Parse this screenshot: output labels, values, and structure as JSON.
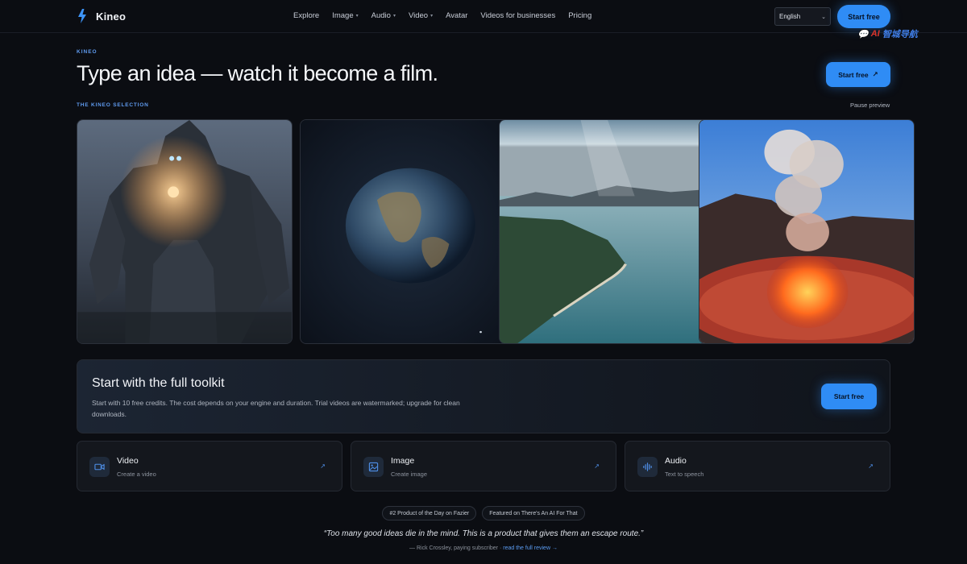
{
  "nav": {
    "brand": "Kineo",
    "items": [
      {
        "label": "Explore",
        "caret": false
      },
      {
        "label": "Image",
        "caret": true
      },
      {
        "label": "Audio",
        "caret": true
      },
      {
        "label": "Video",
        "caret": true
      },
      {
        "label": "Avatar",
        "caret": false
      },
      {
        "label": "Videos for businesses",
        "caret": false
      },
      {
        "label": "Pricing",
        "caret": false
      }
    ],
    "caret_glyph": "▾",
    "language": "English",
    "cta": "Start free"
  },
  "watermark": {
    "prefix": "💬",
    "ai": "AI",
    "text": "智城导航"
  },
  "hero": {
    "eyebrow": "KINEO",
    "title": "Type an idea — watch it become a film.",
    "cta": "Start free",
    "cta_arrow": "↗"
  },
  "selection": {
    "label": "THE KINEO SELECTION",
    "pause": "Pause preview"
  },
  "toolkit": {
    "title": "Start with the full toolkit",
    "description": "Start with 10 free credits. The cost depends on your engine and duration. Trial videos are watermarked; upgrade for clean downloads.",
    "cta": "Start free"
  },
  "tiles": [
    {
      "title": "Video",
      "subtitle": "Create a video",
      "icon": "video-camera-icon",
      "arrow": "↗"
    },
    {
      "title": "Image",
      "subtitle": "Create image",
      "icon": "image-icon",
      "arrow": "↗"
    },
    {
      "title": "Audio",
      "subtitle": "Text to speech",
      "icon": "audio-wave-icon",
      "arrow": "↗"
    }
  ],
  "badges": [
    "#2 Product of the Day on Fazier",
    "Featured on There's An AI For That"
  ],
  "testimonial": {
    "quote": "“Too many good ideas die in the mind. This is a product that gives them an escape route.”",
    "author": "— Rick Crossley, paying subscriber ·",
    "link": "read the full review →"
  },
  "colors": {
    "accent": "#2f8cf5",
    "background": "#0b0d12",
    "eyebrow": "#5f9bf0"
  }
}
